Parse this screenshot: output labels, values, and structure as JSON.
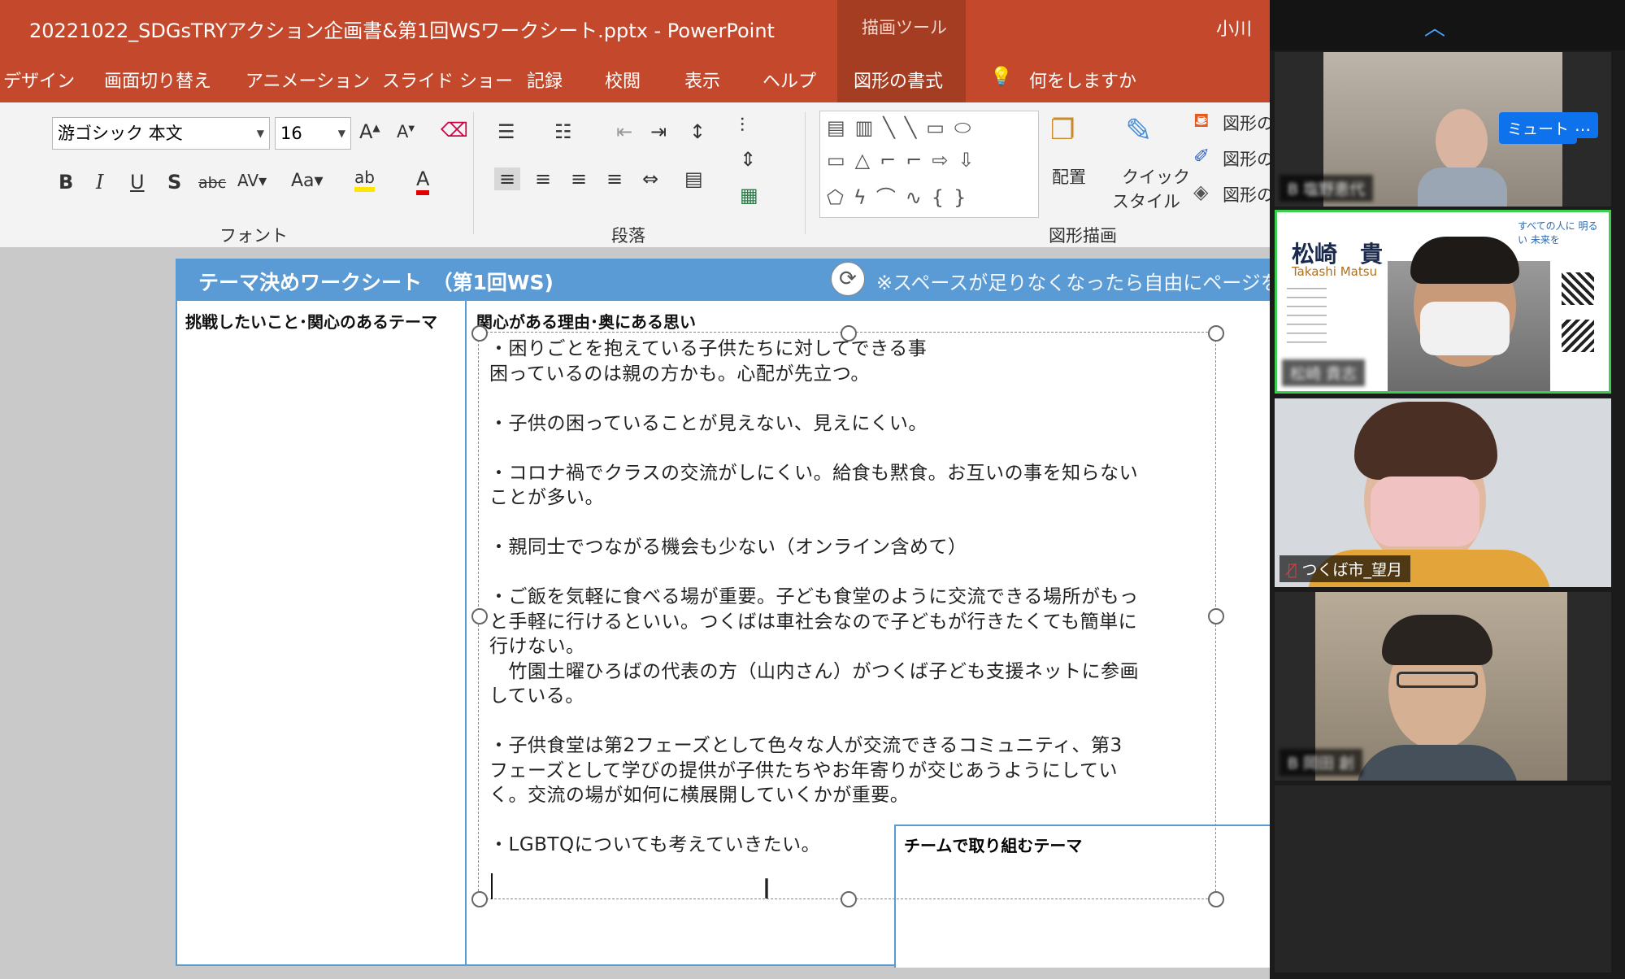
{
  "window": {
    "title": "20221022_SDGsTRYアクション企画書&第1回WSワークシート.pptx  -  PowerPoint",
    "contextual_tab_header": "描画ツール",
    "user_name": "小川"
  },
  "ribbon_tabs": [
    "デザイン",
    "画面切り替え",
    "アニメーション",
    "スライド ショー",
    "記録",
    "校閲",
    "表示",
    "ヘルプ",
    "図形の書式",
    "何をしますか"
  ],
  "font_group": {
    "font_name": "游ゴシック 本文",
    "font_size": "16",
    "label": "フォント"
  },
  "paragraph_group": {
    "label": "段落"
  },
  "drawing_group": {
    "label": "図形描画",
    "arrange": "配置",
    "quick_style_line1": "クイック",
    "quick_style_line2": "スタイル",
    "shape_fill": "図形の",
    "shape_outline": "図形の",
    "shape_effects": "図形の"
  },
  "slide": {
    "header_title": "テーマ決めワークシート　（第1回WS)",
    "header_note": "※スペースが足りなくなったら自由にページを",
    "col1_heading": "挑戦したいこと･関心のあるテーマ",
    "col2_heading": "関心がある理由･奥にある思い",
    "team_heading": "チームで取り組むテーマ",
    "body_paragraphs": [
      "・困りごとを抱えている子供たちに対してできる事\n困っているのは親の方かも。心配が先立つ。",
      "・子供の困っていることが見えない、見えにくい。",
      "・コロナ禍でクラスの交流がしにくい。給食も黙食。お互いの事を知らない\nことが多い。",
      "・親同士でつながる機会も少ない（オンライン含めて）",
      "・ご飯を気軽に食べる場が重要。子ども食堂のように交流できる場所がもっ\nと手軽に行けるといい。つくばは車社会なので子どもが行きたくても簡単に\n行けない。\n　竹園土曜ひろばの代表の方（山内さん）がつくば子ども支援ネットに参画\nしている。",
      "・子供食堂は第2フェーズとして色々な人が交流できるコミュニティ、第3\nフェーズとして学びの提供が子供たちやお年寄りが交じあうようにしてい\nく。交流の場が如何に横展開していくかが重要。",
      "・LGBTQについても考えていきたい。"
    ]
  },
  "zoom": {
    "mute_label": "ミュート",
    "more_label": "…",
    "participants": [
      {
        "name": "B 塩野恵代",
        "blurred": true
      },
      {
        "name": "松崎 貴志",
        "blurred": true,
        "active_speaker": true,
        "background_text_name": "松崎　貴",
        "background_text_roman": "Takashi   Matsu",
        "background_text_corner": "すべての人に 明るい 未来を"
      },
      {
        "name": "つくば市_望月",
        "blurred": false,
        "muted": true
      },
      {
        "name": "B 岡田 創",
        "blurred": true
      }
    ],
    "accent_color": "#0e72ed",
    "speaker_border_color": "#3ccf4e"
  },
  "colors": {
    "ppt_accent": "#c4492c",
    "contextual_tab": "#a53d22",
    "slide_header": "#5b9bd5"
  }
}
